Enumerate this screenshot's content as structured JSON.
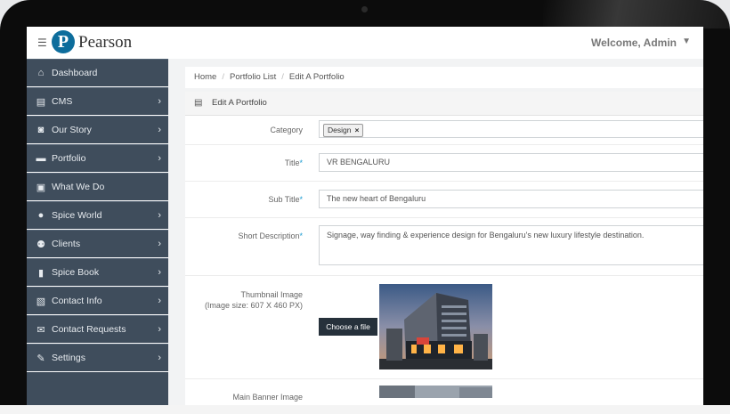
{
  "header": {
    "brand_letter": "P",
    "brand_name": "Pearson",
    "welcome": "Welcome, Admin"
  },
  "sidebar": {
    "items": [
      {
        "label": "Dashboard",
        "icon": "home-icon",
        "has_submenu": false
      },
      {
        "label": "CMS",
        "icon": "document-icon",
        "has_submenu": true
      },
      {
        "label": "Our Story",
        "icon": "camera-icon",
        "has_submenu": true
      },
      {
        "label": "Portfolio",
        "icon": "folder-icon",
        "has_submenu": true
      },
      {
        "label": "What We Do",
        "icon": "briefcase-icon",
        "has_submenu": false
      },
      {
        "label": "Spice World",
        "icon": "user-icon",
        "has_submenu": true
      },
      {
        "label": "Clients",
        "icon": "users-icon",
        "has_submenu": true
      },
      {
        "label": "Spice Book",
        "icon": "book-icon",
        "has_submenu": true
      },
      {
        "label": "Contact Info",
        "icon": "contact-book-icon",
        "has_submenu": true
      },
      {
        "label": "Contact Requests",
        "icon": "envelope-icon",
        "has_submenu": true
      },
      {
        "label": "Settings",
        "icon": "wrench-icon",
        "has_submenu": true
      }
    ]
  },
  "breadcrumb": [
    "Home",
    "Portfolio List",
    "Edit A Portfolio"
  ],
  "panel": {
    "title": "Edit A Portfolio"
  },
  "form": {
    "category": {
      "label": "Category",
      "tag": "Design",
      "tag_remove": "×"
    },
    "title": {
      "label": "Title",
      "required_mark": "*",
      "value": "VR BENGALURU"
    },
    "subtitle": {
      "label": "Sub Title",
      "required_mark": "*",
      "value": "The new heart of Bengaluru"
    },
    "short_description": {
      "label": "Short Description",
      "required_mark": "*",
      "value": "Signage, way finding & experience design for Bengaluru's new luxury lifestyle destination."
    },
    "thumbnail": {
      "label": "Thumbnail Image",
      "hint": "(Image size: 607 X 460 PX)",
      "button": "Choose a file"
    },
    "main_banner": {
      "label": "Main Banner Image"
    }
  },
  "colors": {
    "sidebar_bg": "#3f4d5c",
    "brand_blue": "#0d6d9c",
    "required_star": "#1b9bd1",
    "button_dark": "#26313b"
  }
}
